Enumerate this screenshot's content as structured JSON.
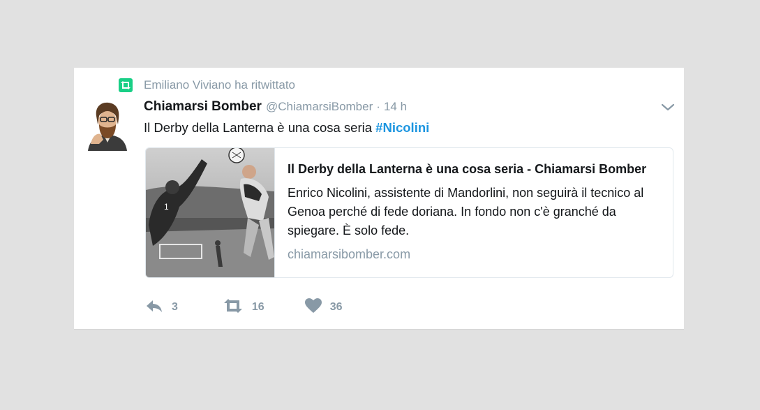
{
  "retweet": {
    "text": "Emiliano Viviano ha ritwittato",
    "icon": "retweet-icon",
    "color": "#19cf86"
  },
  "tweet": {
    "name": "Chiamarsi Bomber",
    "handle": "@ChiamarsiBomber",
    "separator": "·",
    "time": "14 h",
    "text": "Il Derby della Lanterna è una cosa seria",
    "hashtag": "#Nicolini"
  },
  "card": {
    "title": "Il Derby della Lanterna è una cosa seria - Chiamarsi Bomber",
    "description": "Enrico Nicolini, assistente di Mandorlini, non seguirà il tecnico al Genoa perché di fede doriana. In fondo non c'è granché da spiegare. È solo fede.",
    "domain": "chiamarsibomber.com"
  },
  "actions": {
    "reply_count": "3",
    "retweet_count": "16",
    "like_count": "36"
  },
  "colors": {
    "accent": "#1b95e0",
    "muted": "#8899a6",
    "text": "#14171a"
  }
}
